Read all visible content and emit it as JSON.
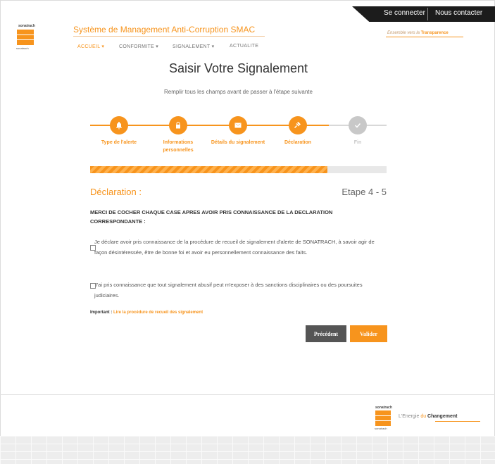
{
  "topbar": {
    "login": "Se connecter",
    "contact": "Nous contacter"
  },
  "brand": {
    "logo_name": "sonatrach",
    "logo_sub": "sonatrach"
  },
  "header": {
    "title": "Système de Management Anti-Corruption SMAC",
    "nav": [
      "ACCUEIL ▾",
      "CONFORMITE ▾",
      "SIGNALEMENT ▾",
      "ACTUALITE"
    ],
    "slogan_prefix": "Ensemble vers la ",
    "slogan_emph": "Transparence"
  },
  "page": {
    "title": "Saisir Votre Signalement",
    "instructions": "Remplir tous les champs avant de passer à l'étape suivante"
  },
  "steps": [
    {
      "label": "Type de l'alerte",
      "icon": "bell-icon",
      "status": "done"
    },
    {
      "label": "Informations personnelles",
      "icon": "lock-icon",
      "status": "done"
    },
    {
      "label": "Détails du signalement",
      "icon": "envelope-icon",
      "status": "done"
    },
    {
      "label": "Déclaration",
      "icon": "gavel-icon",
      "status": "active"
    },
    {
      "label": "Fin",
      "icon": "check-icon",
      "status": "pending"
    }
  ],
  "progress": {
    "percent": 80
  },
  "section": {
    "title": "Déclaration :",
    "step_indicator": "Etape 4 - 5",
    "notice": "MERCI DE COCHER CHAQUE CASE APRES AVOIR PRIS CONNAISSANCE DE LA DECLARATION CORRESPONDANTE :"
  },
  "declarations": [
    {
      "text": "Je déclare avoir pris connaissance de la procédure de recueil de signalement d'alerte de SONATRACH, à savoir agir de façon désintéressée, être de bonne foi et avoir eu personnellement connaissance des faits.",
      "checked": false
    },
    {
      "text": "J'ai pris connaissance que tout signalement abusif peut m'exposer à des sanctions disciplinaires ou des poursuites judiciaires.",
      "checked": false
    }
  ],
  "important": {
    "label": "Important :",
    "link": "Lire la procédure de recueil des signalement"
  },
  "buttons": {
    "previous": "Précédent",
    "submit": "Valider"
  },
  "footer": {
    "slogan_prefix": "L'Energie ",
    "slogan_du": "du ",
    "slogan_emph": "Changement"
  },
  "colors": {
    "accent": "#f7941d",
    "dark": "#1c1c1c",
    "button_secondary": "#555555",
    "inactive": "#c8c8c8"
  }
}
